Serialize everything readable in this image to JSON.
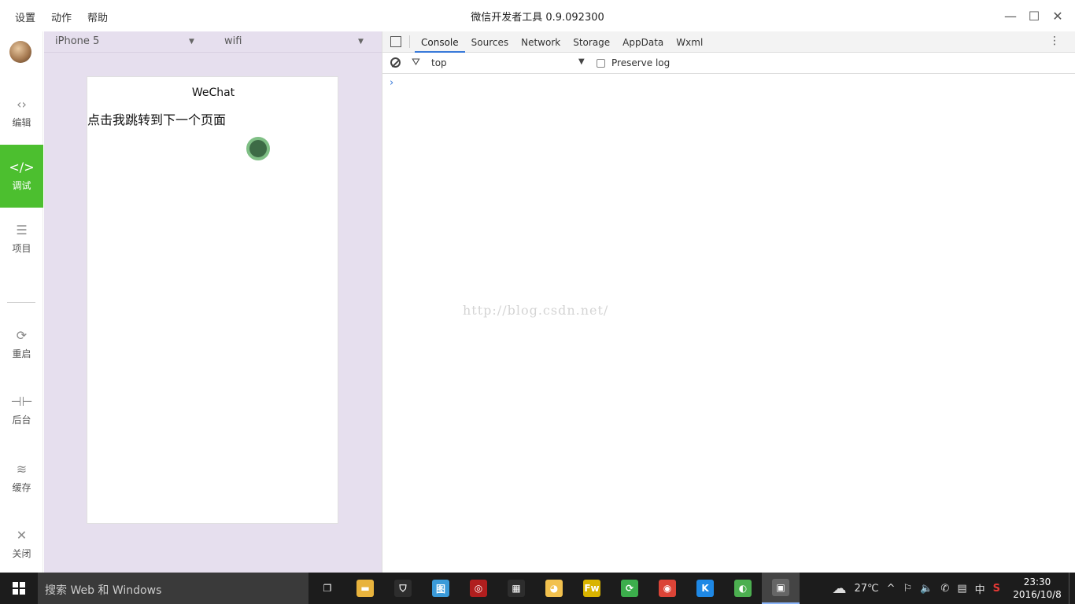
{
  "menubar": {
    "menus": [
      "设置",
      "动作",
      "帮助"
    ],
    "title": "微信开发者工具 0.9.092300"
  },
  "window_controls": {
    "minimize": "—",
    "maximize": "☐",
    "close": "✕"
  },
  "sidebar": {
    "items": [
      {
        "label": "编辑",
        "icon": "code-box-icon",
        "glyph": "‹›"
      },
      {
        "label": "调试",
        "icon": "debug-code-icon",
        "glyph": "</>"
      },
      {
        "label": "项目",
        "icon": "menu-lines-icon",
        "glyph": "☰"
      },
      {
        "label": "重启",
        "icon": "restart-icon",
        "glyph": "⟳"
      },
      {
        "label": "后台",
        "icon": "background-icon",
        "glyph": "⊣⊢"
      },
      {
        "label": "缓存",
        "icon": "layers-icon",
        "glyph": "≋"
      },
      {
        "label": "关闭",
        "icon": "close-icon",
        "glyph": "✕"
      }
    ],
    "active_color": "#4cbf2f"
  },
  "simulator": {
    "device": "iPhone 5",
    "network": "wifi",
    "page_title": "WeChat",
    "link_text": "点击我跳转到下一个页面",
    "background": "#e6dfee"
  },
  "devtools": {
    "tabs": [
      "Console",
      "Sources",
      "Network",
      "Storage",
      "AppData",
      "Wxml"
    ],
    "active_tab": "Console",
    "context": "top",
    "preserve_log": "Preserve log",
    "prompt": "›",
    "watermark": "http://blog.csdn.net/",
    "more_icon": "⋮"
  },
  "taskbar": {
    "search_placeholder": "搜索 Web 和 Windows",
    "apps": [
      {
        "name": "task-view-icon",
        "glyph": "❐",
        "color": "#1c1c1c"
      },
      {
        "name": "file-explorer-icon",
        "glyph": "▬",
        "color": "#e8b33d"
      },
      {
        "name": "store-icon",
        "glyph": "⛉",
        "color": "#2d2d2d"
      },
      {
        "name": "app-blue-icon",
        "glyph": "图",
        "color": "#3a9ad9"
      },
      {
        "name": "app-red-icon",
        "glyph": "◎",
        "color": "#b01e1e"
      },
      {
        "name": "calculator-icon",
        "glyph": "▦",
        "color": "#2d2d2d"
      },
      {
        "name": "paint-icon",
        "glyph": "◕",
        "color": "#f2c14e"
      },
      {
        "name": "fireworks-icon",
        "glyph": "Fw",
        "color": "#d9b400"
      },
      {
        "name": "sync-icon",
        "glyph": "⟳",
        "color": "#3cae4c"
      },
      {
        "name": "chrome-icon",
        "glyph": "◉",
        "color": "#db4437"
      },
      {
        "name": "k-app-icon",
        "glyph": "K",
        "color": "#1e88e5"
      },
      {
        "name": "eclipse-icon",
        "glyph": "◐",
        "color": "#4caf50"
      },
      {
        "name": "wechat-devtool-icon",
        "glyph": "▣",
        "color": "#666"
      }
    ],
    "tray": {
      "weather": "☁",
      "temperature": "27℃",
      "chevron": "^",
      "icons": [
        "⚐",
        "🔈",
        "✆",
        "▤",
        "中",
        "S"
      ],
      "time": "23:30",
      "date": "2016/10/8"
    }
  }
}
